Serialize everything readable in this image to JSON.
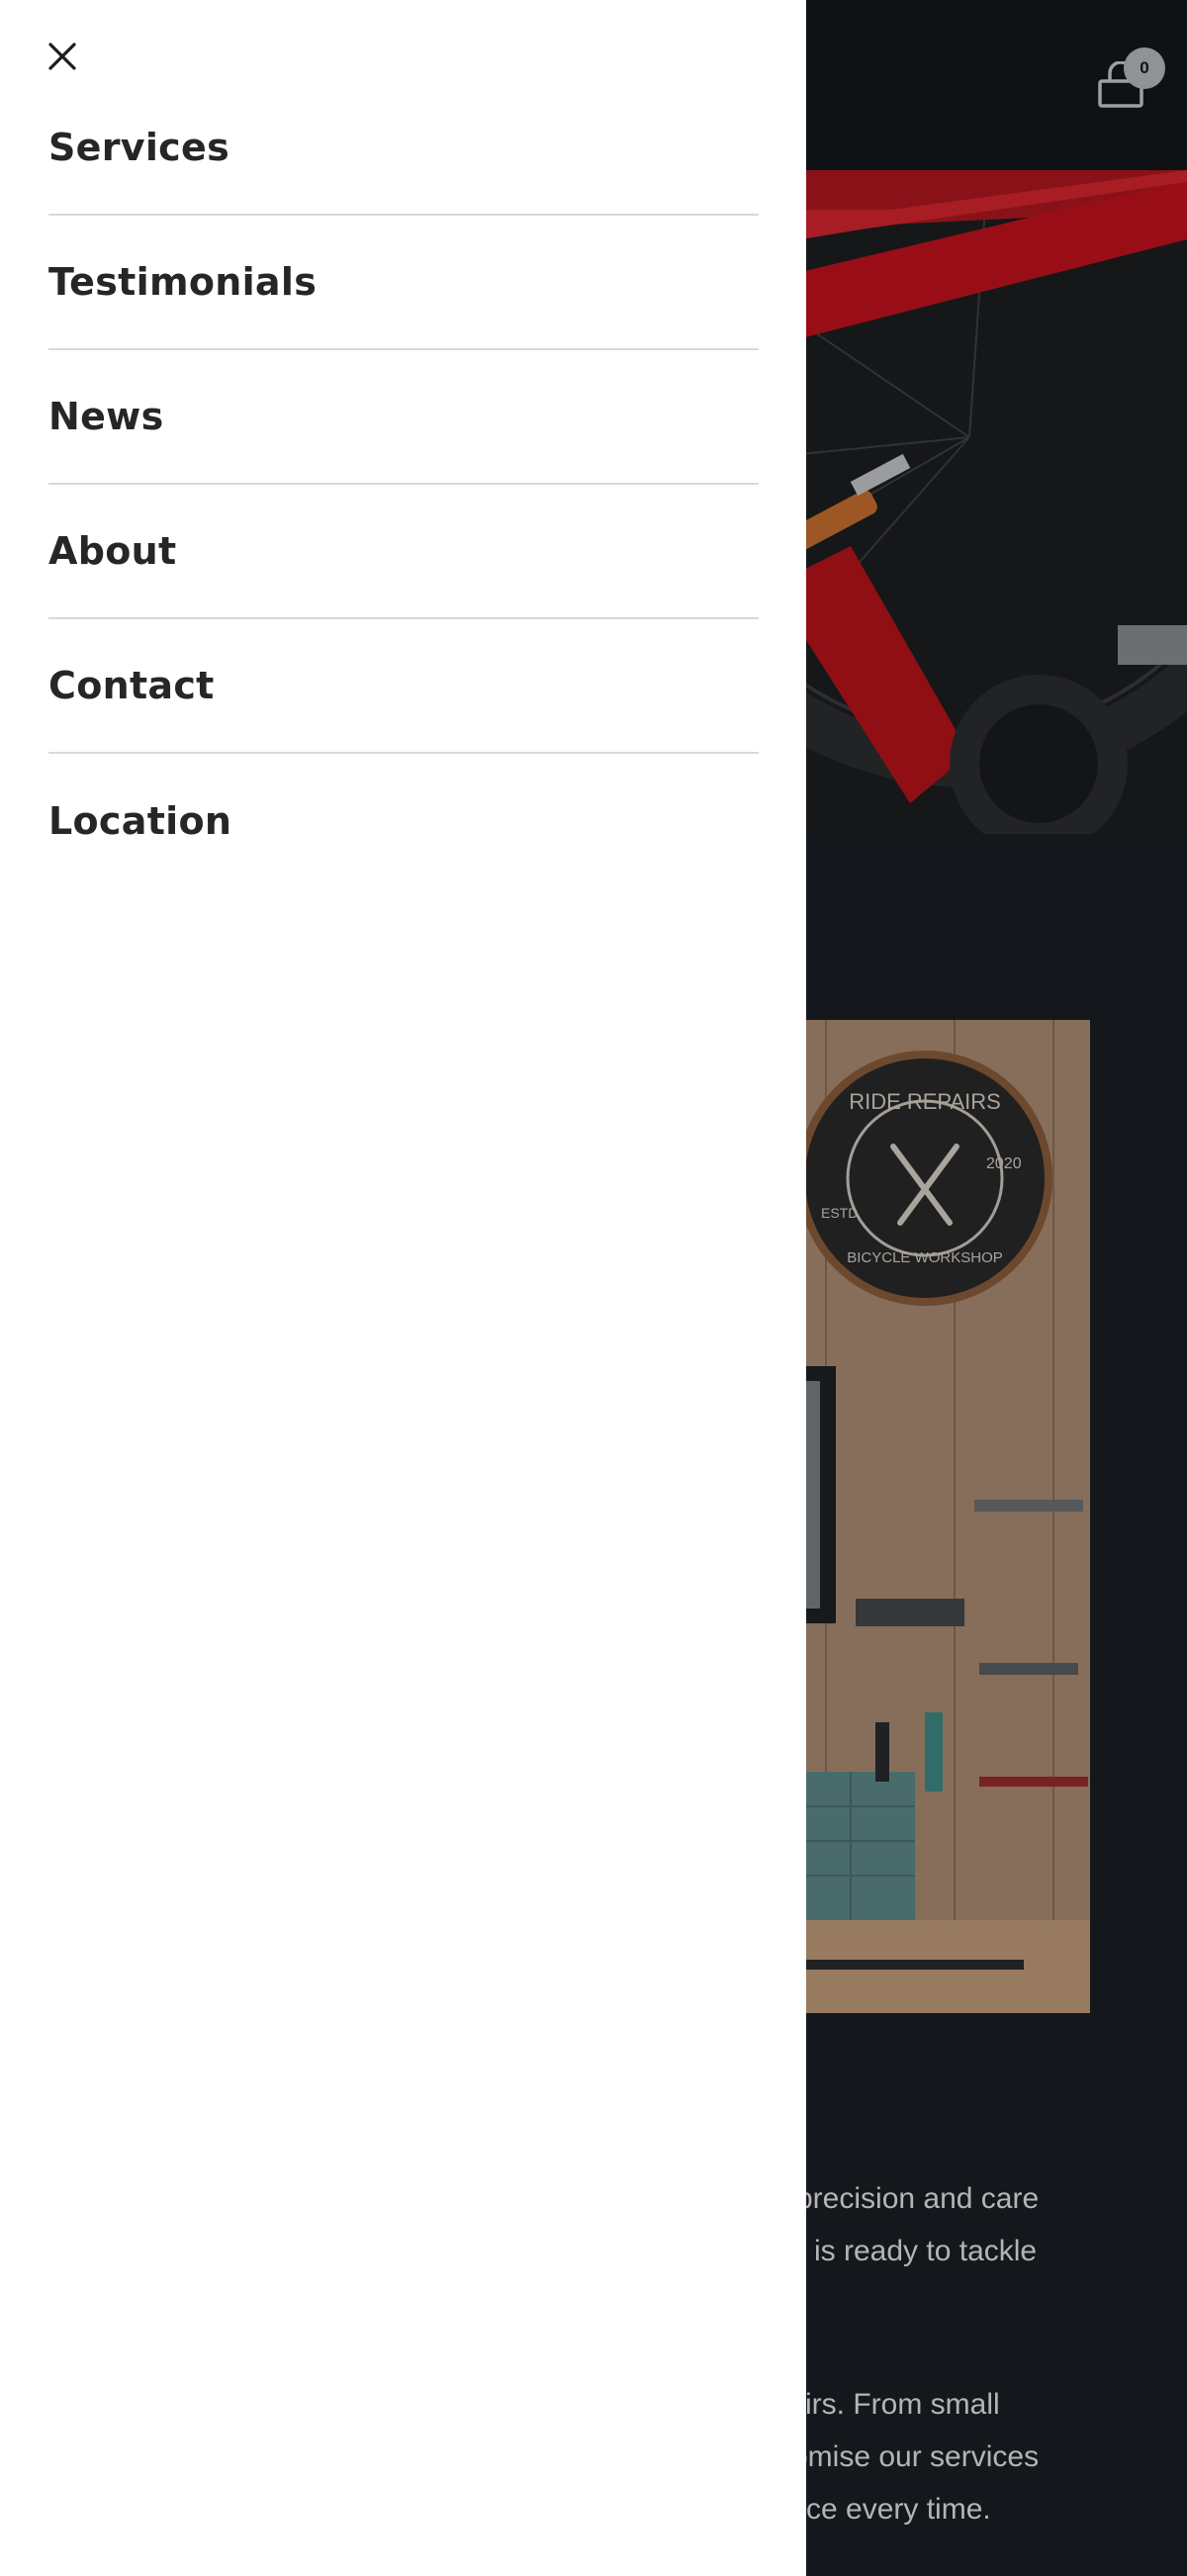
{
  "header": {
    "cart_icon": "bag-icon",
    "cart_count": "0"
  },
  "hero": {
    "image": "red-bicycle-repair-photo"
  },
  "workshop_image": {
    "image": "workshop-wall-photo",
    "sign": {
      "top_text": "RIDE REPAIRS",
      "bottom_text": "BICYCLE WORKSHOP",
      "left_text": "ESTD",
      "right_text": "2020"
    }
  },
  "body_text": {
    "paragraph_1": [
      "precision and care",
      "is ready to tackle"
    ],
    "paragraph_2": [
      "irs. From small",
      "omise our services",
      "ce every time."
    ]
  },
  "drawer": {
    "close_icon": "close-icon",
    "menu": [
      {
        "label": "Services"
      },
      {
        "label": "Testimonials"
      },
      {
        "label": "News"
      },
      {
        "label": "About"
      },
      {
        "label": "Contact"
      },
      {
        "label": "Location"
      }
    ]
  },
  "colors": {
    "drawer_bg": "#ffffff",
    "page_bg": "#1a1f24",
    "header_bg": "#13181b",
    "menu_text": "#262626",
    "divider": "#d9d9d9",
    "bike_red": "#c4131d"
  }
}
